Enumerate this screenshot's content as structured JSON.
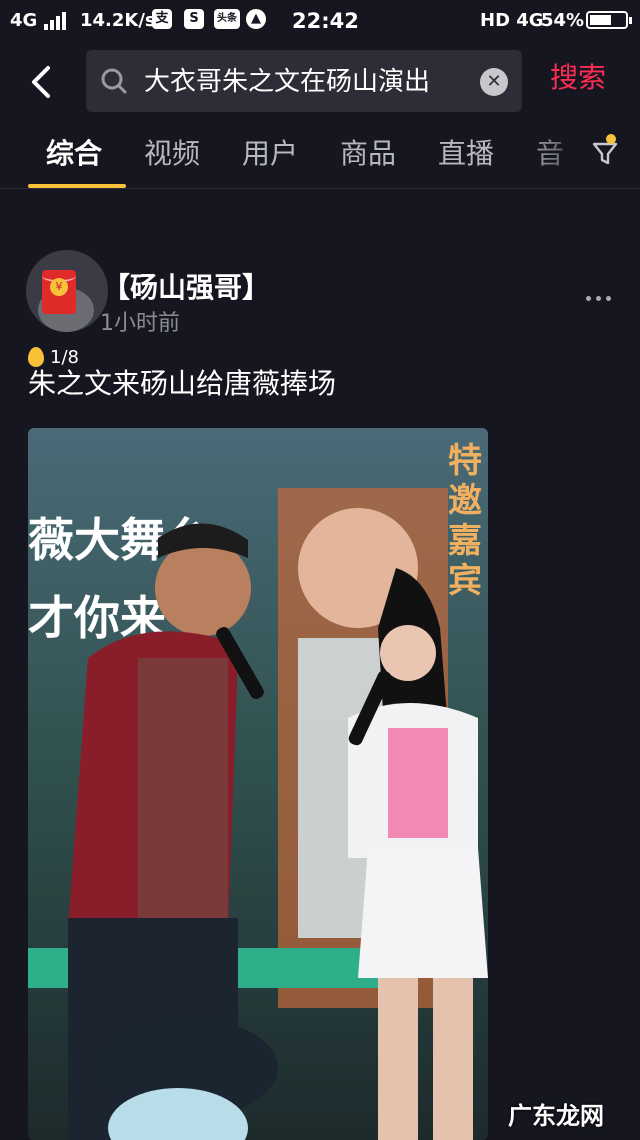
{
  "status_bar": {
    "network": "4G",
    "speed": "14.2K/s",
    "notif_icons": [
      "支",
      "S",
      "头条",
      "▲"
    ],
    "time": "22:42",
    "hd_network": "HD 4G",
    "battery": "54%",
    "battery_level": 0.54
  },
  "search": {
    "query": "大衣哥朱之文在砀山演出",
    "submit_label": "搜索",
    "clear_symbol": "✕"
  },
  "tabs": [
    {
      "label": "综合",
      "active": true
    },
    {
      "label": "视频",
      "active": false
    },
    {
      "label": "用户",
      "active": false
    },
    {
      "label": "商品",
      "active": false
    },
    {
      "label": "直播",
      "active": false
    },
    {
      "label": "音",
      "active": false
    }
  ],
  "post": {
    "username": "【砀山强哥】",
    "time_ago": "1小时前",
    "counter": "1/8",
    "caption": "朱之文来砀山给唐薇捧场",
    "media_overlay": {
      "banner_line1": "薇大舞台",
      "banner_line2": "才你来",
      "banner_vertical": "特邀嘉宾"
    },
    "redpacket_char": "¥"
  },
  "watermark": "广东龙网",
  "colors": {
    "accent_red": "#fe2c55",
    "tab_indicator": "#f7c23a",
    "background": "#15161f"
  },
  "icons": [
    "back-arrow-icon",
    "search-icon",
    "clear-icon",
    "filter-icon",
    "more-icon",
    "red-packet-icon",
    "gold-egg-icon"
  ]
}
